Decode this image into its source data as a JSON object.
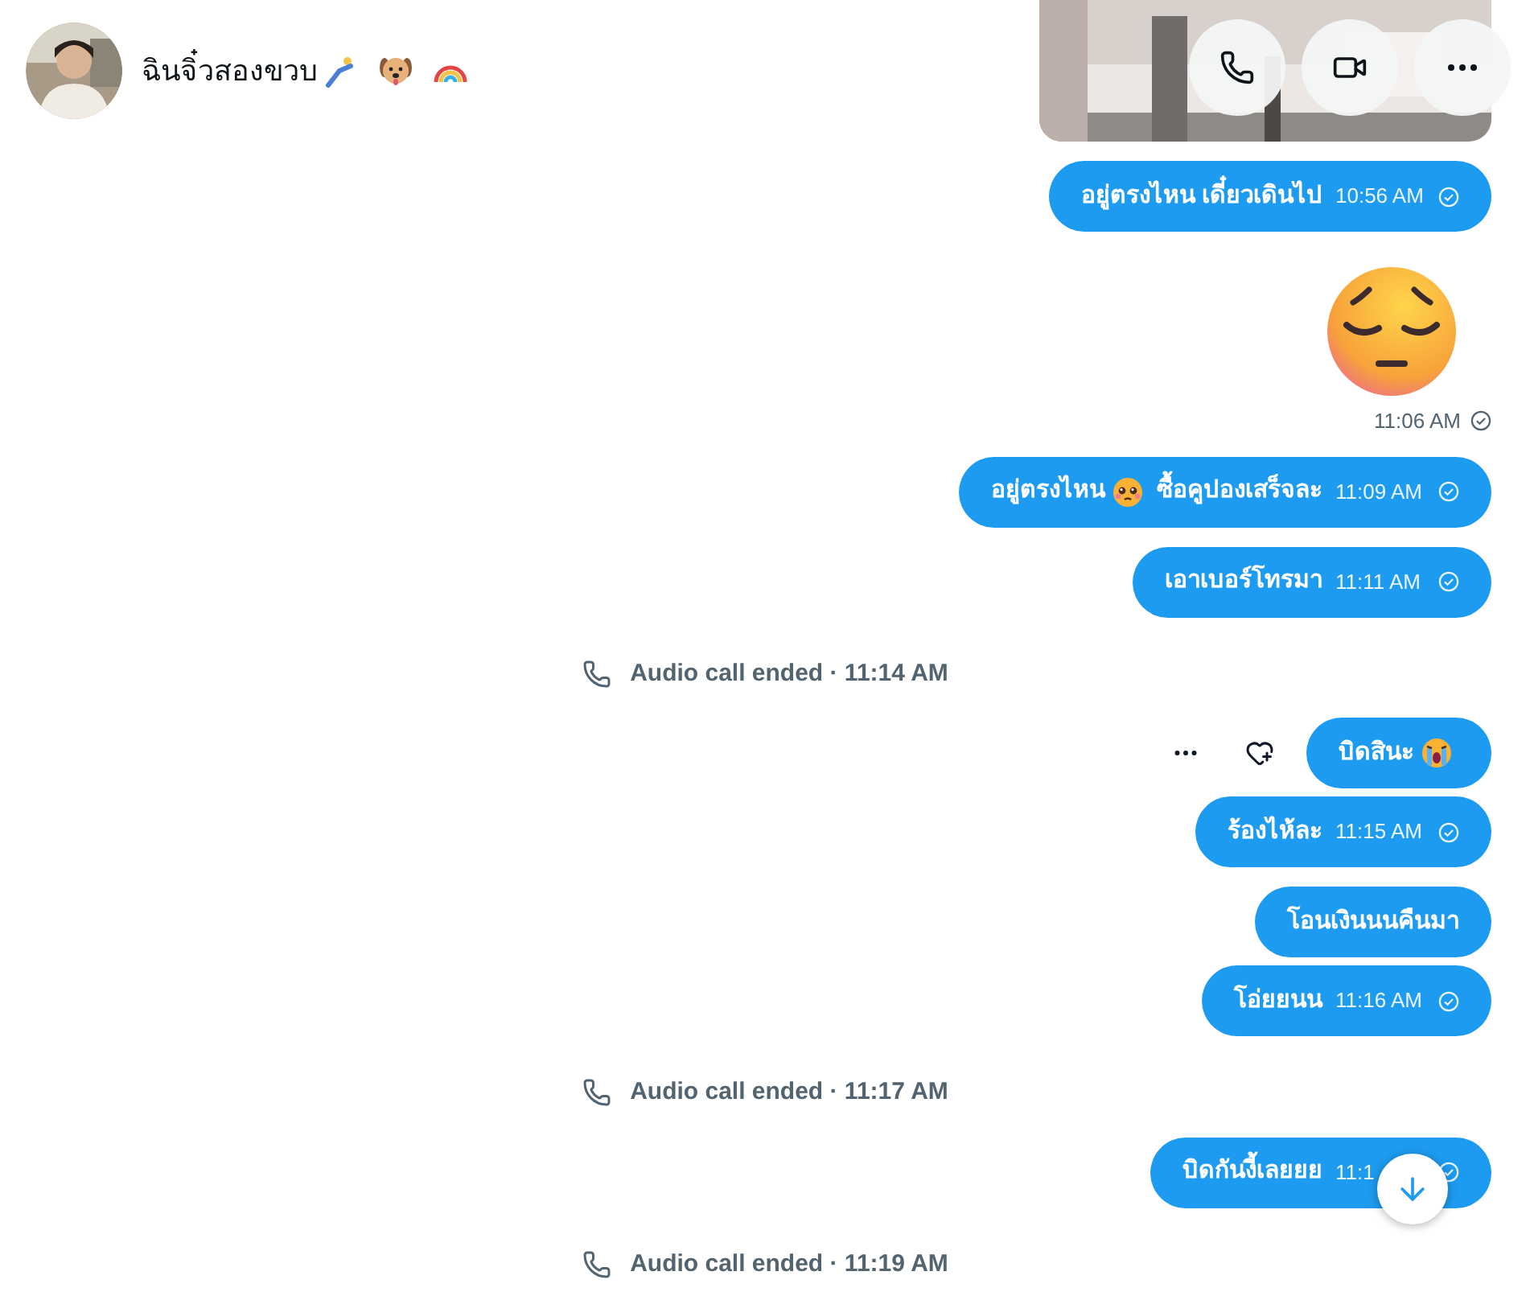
{
  "header": {
    "name": "ฉินจิ๋วสองขวบ",
    "actions": [
      {
        "kind": "call"
      },
      {
        "kind": "video"
      },
      {
        "kind": "more"
      }
    ]
  },
  "messages": [
    {
      "kind": "text",
      "text": "อยู่ตรงไหน เดี๋ยวเดินไป",
      "time": "10:56 AM"
    },
    {
      "kind": "emoji",
      "time": "11:06 AM"
    },
    {
      "kind": "text",
      "text": "อยู่ตรงไหน",
      "crying": false,
      "text_after": "ซื้อคูปองเสร็จละ",
      "time": "11:09 AM"
    },
    {
      "kind": "text",
      "text": "เอาเบอร์โทรมา",
      "time": "11:11 AM"
    },
    {
      "kind": "call",
      "text": "Audio call ended · 11:14 AM"
    },
    {
      "kind": "text",
      "text": "บิดสินะ",
      "crying": true,
      "hovered": true
    },
    {
      "kind": "text",
      "text": "ร้องไห้ละ",
      "time": "11:15 AM"
    },
    {
      "kind": "text",
      "text": "โอนเงินนนคืนมา"
    },
    {
      "kind": "text",
      "text": "โอ่ยยนน",
      "time": "11:16 AM"
    },
    {
      "kind": "call",
      "text": "Audio call ended · 11:17 AM"
    },
    {
      "kind": "text",
      "text": "บิดกันงี้เลยยย",
      "time": "11:1"
    },
    {
      "kind": "call",
      "text": "Audio call ended · 11:19 AM"
    }
  ]
}
